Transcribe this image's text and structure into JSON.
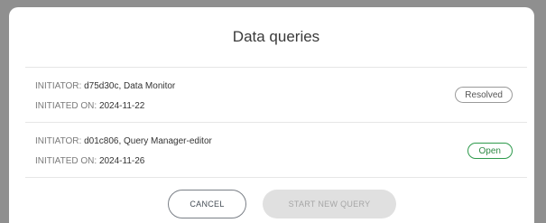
{
  "dialog": {
    "title": "Data queries",
    "queries": [
      {
        "initiator_label": "INITIATOR:",
        "initiator_value": "d75d30c, Data Monitor",
        "initiated_label": "INITIATED ON:",
        "initiated_value": "2024-11-22",
        "status": "Resolved"
      },
      {
        "initiator_label": "INITIATOR:",
        "initiator_value": "d01c806, Query Manager-editor",
        "initiated_label": "INITIATED ON:",
        "initiated_value": "2024-11-26",
        "status": "Open"
      }
    ],
    "buttons": {
      "cancel": "CANCEL",
      "start_new_query": "START NEW QUERY"
    }
  },
  "colors": {
    "open_status": "#2e9a4c",
    "resolved_status": "#9a9a9a",
    "disabled_button": "#e0e0e0"
  }
}
